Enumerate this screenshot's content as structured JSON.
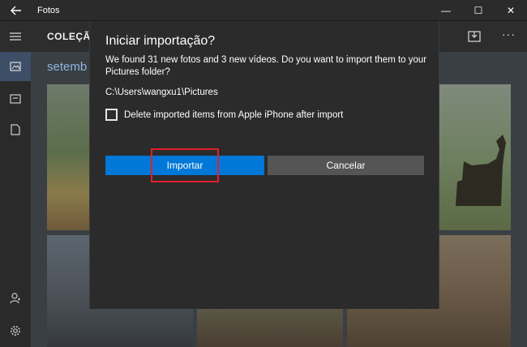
{
  "window": {
    "title": "Fotos",
    "controls": {
      "minimize": "—",
      "maximize": "☐",
      "close": "✕"
    }
  },
  "appbar": {
    "title": "COLEÇÃ",
    "more": "···"
  },
  "content": {
    "section_label": "setemb"
  },
  "dialog": {
    "title": "Iniciar importação?",
    "message": "We found 31 new fotos and 3 new vídeos. Do you want to import them to your Pictures folder?",
    "path": "C:\\Users\\wangxu1\\Pictures",
    "checkbox_label": "Delete imported items from Apple iPhone after import",
    "checkbox_checked": false,
    "primary_button": "Importar",
    "secondary_button": "Cancelar"
  },
  "colors": {
    "accent": "#0078d7",
    "highlight": "#e0202a"
  }
}
